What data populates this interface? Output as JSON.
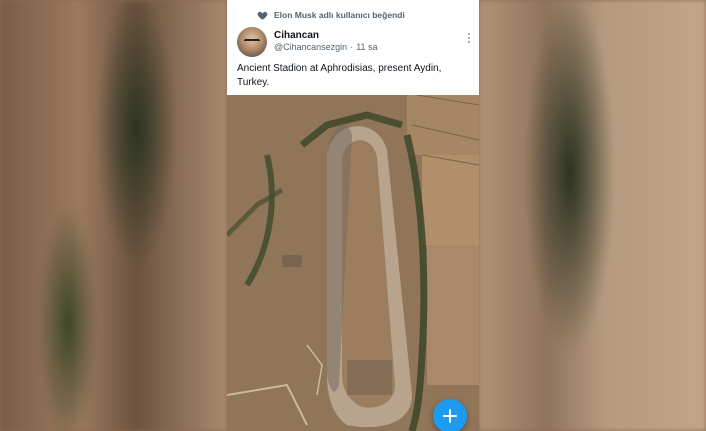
{
  "social_context": {
    "text": "Elon Musk adlı kullanıcı beğendi",
    "icon": "heart-icon"
  },
  "tweet": {
    "author_name": "Cihancan",
    "author_handle": "@Cihancansezgin",
    "separator": "·",
    "time": "11 sa",
    "text": "Ancient Stadion at Aphrodisias, present Aydin, Turkey."
  },
  "actions": {
    "more_icon": "more-icon",
    "compose_icon": "plus-icon"
  },
  "colors": {
    "accent": "#1d9bf0",
    "text": "#0f1419",
    "muted": "#536471"
  }
}
